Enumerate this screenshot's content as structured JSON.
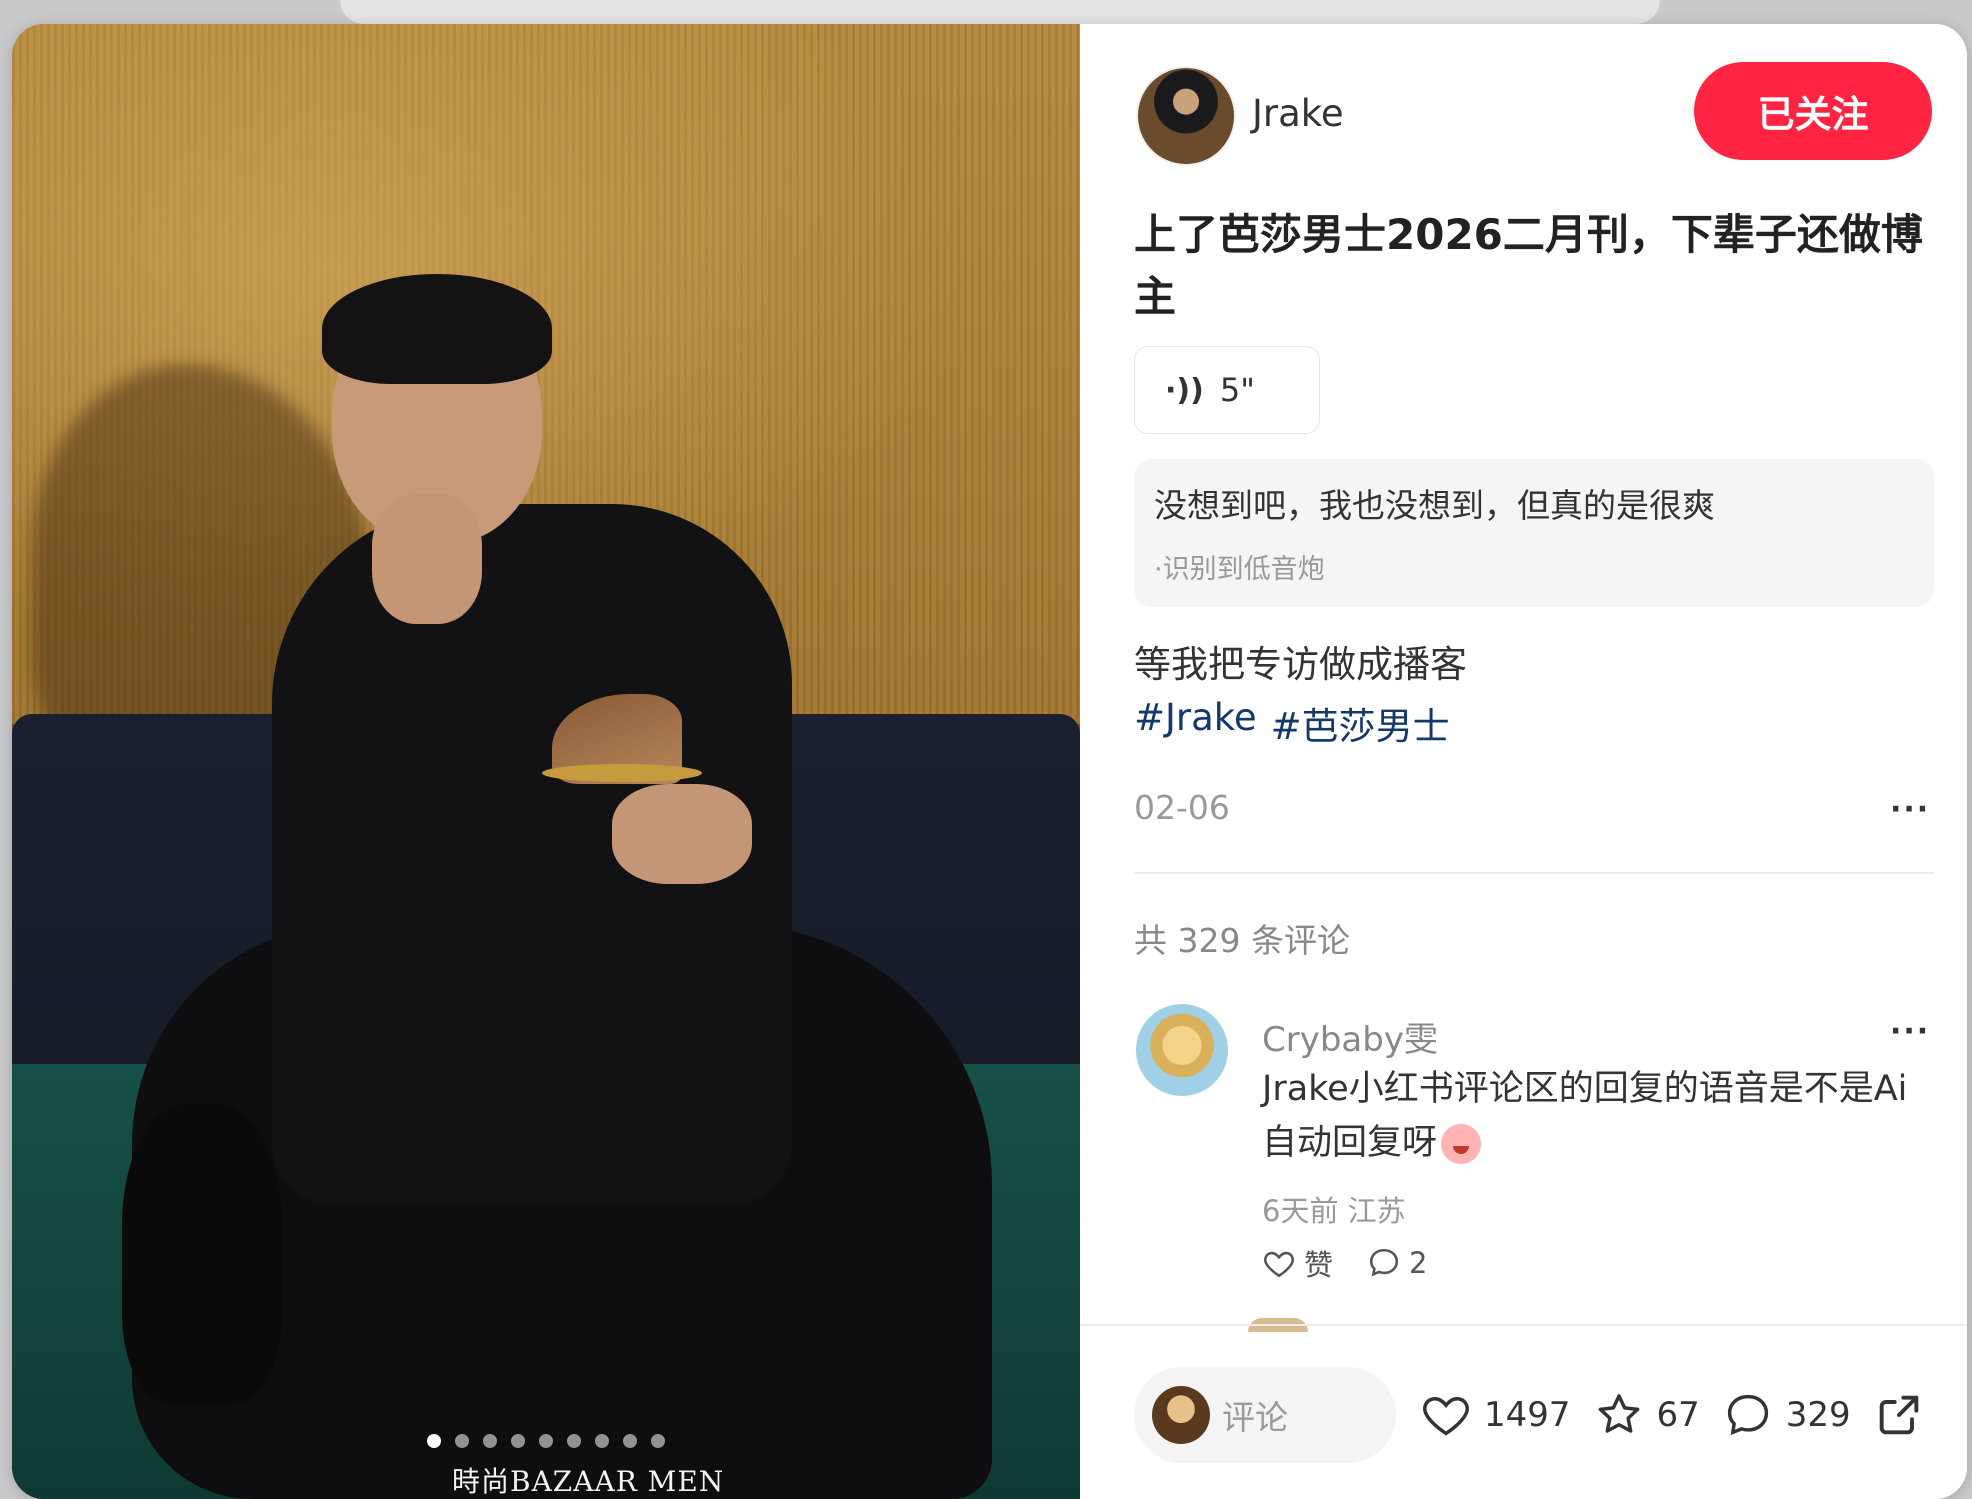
{
  "author": {
    "name": "Jrake",
    "follow_label": "已关注"
  },
  "post": {
    "title": "上了芭莎男士2026二月刊，下辈子还做博主",
    "voice": {
      "icon": "voice-wave-icon",
      "duration": "5\""
    },
    "transcript": {
      "text": "没想到吧，我也没想到，但真的是很爽",
      "source": "·识别到低音炮"
    },
    "body": "等我把专访做成播客",
    "tags": [
      "#Jrake",
      "#芭莎男士"
    ],
    "date": "02-06"
  },
  "photo": {
    "watermark": "時尚BAZAAR MEN",
    "total_images": 9,
    "active_index": 0
  },
  "comments": {
    "count_label": "共 329 条评论",
    "items": [
      {
        "user": "Crybaby雯",
        "text": "Jrake小红书评论区的回复的语音是不是Ai自动回复呀",
        "meta": "6天前 江苏",
        "like_label": "赞",
        "reply_count": "2"
      }
    ]
  },
  "footer": {
    "comment_placeholder": "评论",
    "likes": "1497",
    "collects": "67",
    "comments": "329"
  },
  "colors": {
    "accent": "#ff2442",
    "tag": "#13386c"
  }
}
